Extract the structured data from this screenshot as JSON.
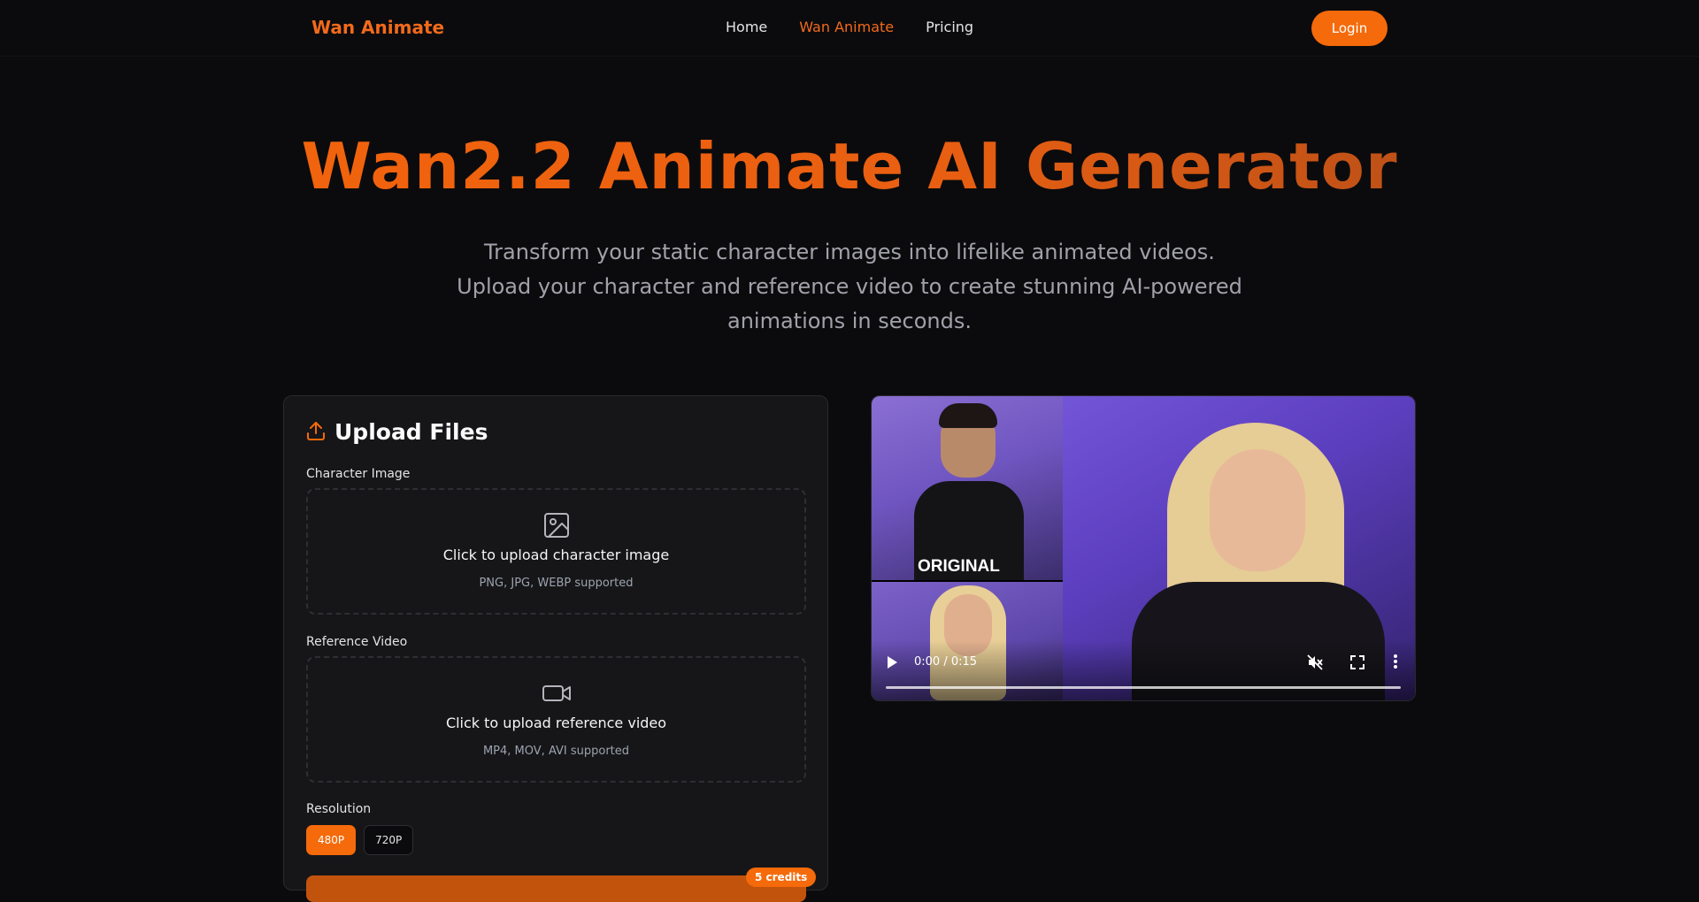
{
  "nav": {
    "brand": "Wan Animate",
    "links": [
      {
        "label": "Home",
        "active": false
      },
      {
        "label": "Wan Animate",
        "active": true
      },
      {
        "label": "Pricing",
        "active": false
      }
    ],
    "login_label": "Login"
  },
  "hero": {
    "title": "Wan2.2 Animate AI Generator",
    "subtitle_line1": "Transform your static character images into lifelike animated videos.",
    "subtitle_line2": "Upload your character and reference video to create stunning AI-powered animations in seconds."
  },
  "upload": {
    "title": "Upload Files",
    "character": {
      "label": "Character Image",
      "prompt": "Click to upload character image",
      "hint": "PNG, JPG, WEBP supported"
    },
    "video": {
      "label": "Reference Video",
      "prompt": "Click to upload reference video",
      "hint": "MP4, MOV, AVI supported"
    },
    "resolution": {
      "label": "Resolution",
      "options": [
        "480P",
        "720P"
      ],
      "selected": "480P"
    },
    "credits_badge": "5 credits"
  },
  "video_player": {
    "overlay_label": "ORIGINAL",
    "time": "0:00 / 0:15",
    "muted": true,
    "progress": 0
  },
  "colors": {
    "accent": "#f56a0a",
    "background": "#0b0b0d",
    "panel": "#161618"
  }
}
